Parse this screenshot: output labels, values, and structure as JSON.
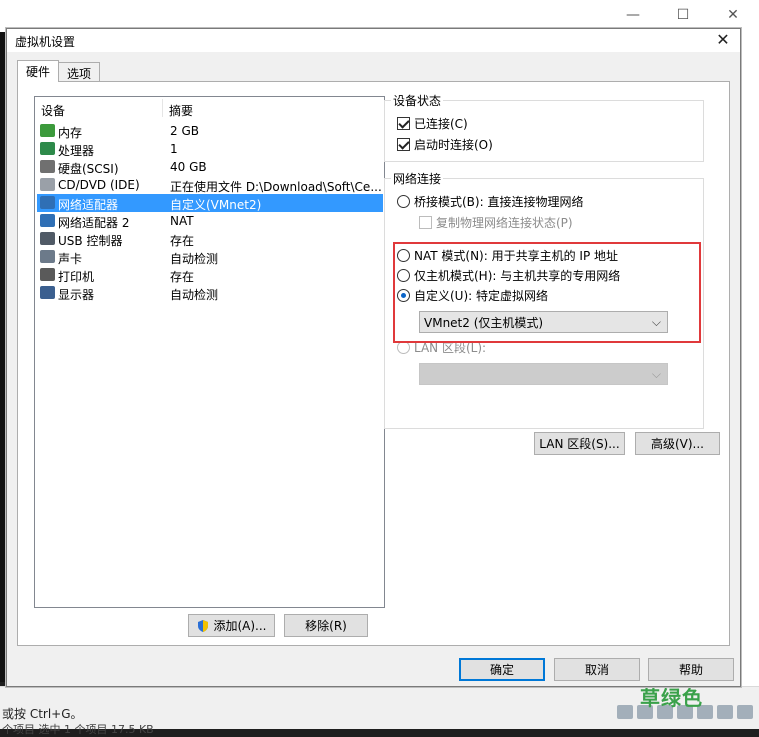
{
  "host": {
    "controls": {
      "minimize": "—",
      "maximize": "☐",
      "close": "✕"
    },
    "hint": "或按 Ctrl+G。",
    "status": "个项目    选中 1 个项目  17.5 KB",
    "watermark": "草绿色"
  },
  "dialog": {
    "title": "虚拟机设置",
    "close": "✕",
    "tabs": [
      {
        "label": "硬件",
        "active": true
      },
      {
        "label": "选项",
        "active": false
      }
    ],
    "device_list": {
      "columns": [
        "设备",
        "摘要"
      ],
      "rows": [
        {
          "name": "内存",
          "summary": "2 GB",
          "icon": "memory-icon",
          "color": "#3c9a3c",
          "selected": false
        },
        {
          "name": "处理器",
          "summary": "1",
          "icon": "processor-icon",
          "color": "#2d8a4a",
          "selected": false
        },
        {
          "name": "硬盘(SCSI)",
          "summary": "40 GB",
          "icon": "harddisk-icon",
          "color": "#707070",
          "selected": false
        },
        {
          "name": "CD/DVD (IDE)",
          "summary": "正在使用文件 D:\\Download\\Soft\\Ce...",
          "icon": "cd-icon",
          "color": "#9aa0a8",
          "selected": false
        },
        {
          "name": "网络适配器",
          "summary": "自定义(VMnet2)",
          "icon": "network-adapter-icon",
          "color": "#2f6fb5",
          "selected": true
        },
        {
          "name": "网络适配器 2",
          "summary": "NAT",
          "icon": "network-adapter-icon",
          "color": "#2f6fb5",
          "selected": false
        },
        {
          "name": "USB 控制器",
          "summary": "存在",
          "icon": "usb-icon",
          "color": "#505a66",
          "selected": false
        },
        {
          "name": "声卡",
          "summary": "自动检测",
          "icon": "sound-icon",
          "color": "#6c7a8a",
          "selected": false
        },
        {
          "name": "打印机",
          "summary": "存在",
          "icon": "printer-icon",
          "color": "#5a5a5a",
          "selected": false
        },
        {
          "name": "显示器",
          "summary": "自动检测",
          "icon": "display-icon",
          "color": "#3b5f8f",
          "selected": false
        }
      ]
    },
    "add_button": "添加(A)...",
    "remove_button": "移除(R)",
    "device_status": {
      "title": "设备状态",
      "connected": {
        "label": "已连接(C)",
        "checked": true
      },
      "connect_on_power": {
        "label": "启动时连接(O)",
        "checked": true
      }
    },
    "network": {
      "title": "网络连接",
      "bridged": {
        "label": "桥接模式(B): 直接连接物理网络",
        "checked": false
      },
      "replicate": {
        "label": "复制物理网络连接状态(P)",
        "checked": false,
        "disabled": true
      },
      "nat": {
        "label": "NAT 模式(N): 用于共享主机的 IP 地址",
        "checked": false
      },
      "host_only": {
        "label": "仅主机模式(H): 与主机共享的专用网络",
        "checked": false
      },
      "custom": {
        "label": "自定义(U): 特定虚拟网络",
        "checked": true
      },
      "custom_select": "VMnet2 (仅主机模式)",
      "lan": {
        "label": "LAN 区段(L):",
        "checked": false,
        "disabled": true
      },
      "lan_select": ""
    },
    "lan_segments_button": "LAN 区段(S)...",
    "advanced_button": "高级(V)...",
    "ok_button": "确定",
    "cancel_button": "取消",
    "help_button": "帮助",
    "accent_color": "#0078d7",
    "highlight_color": "#e0393b"
  }
}
